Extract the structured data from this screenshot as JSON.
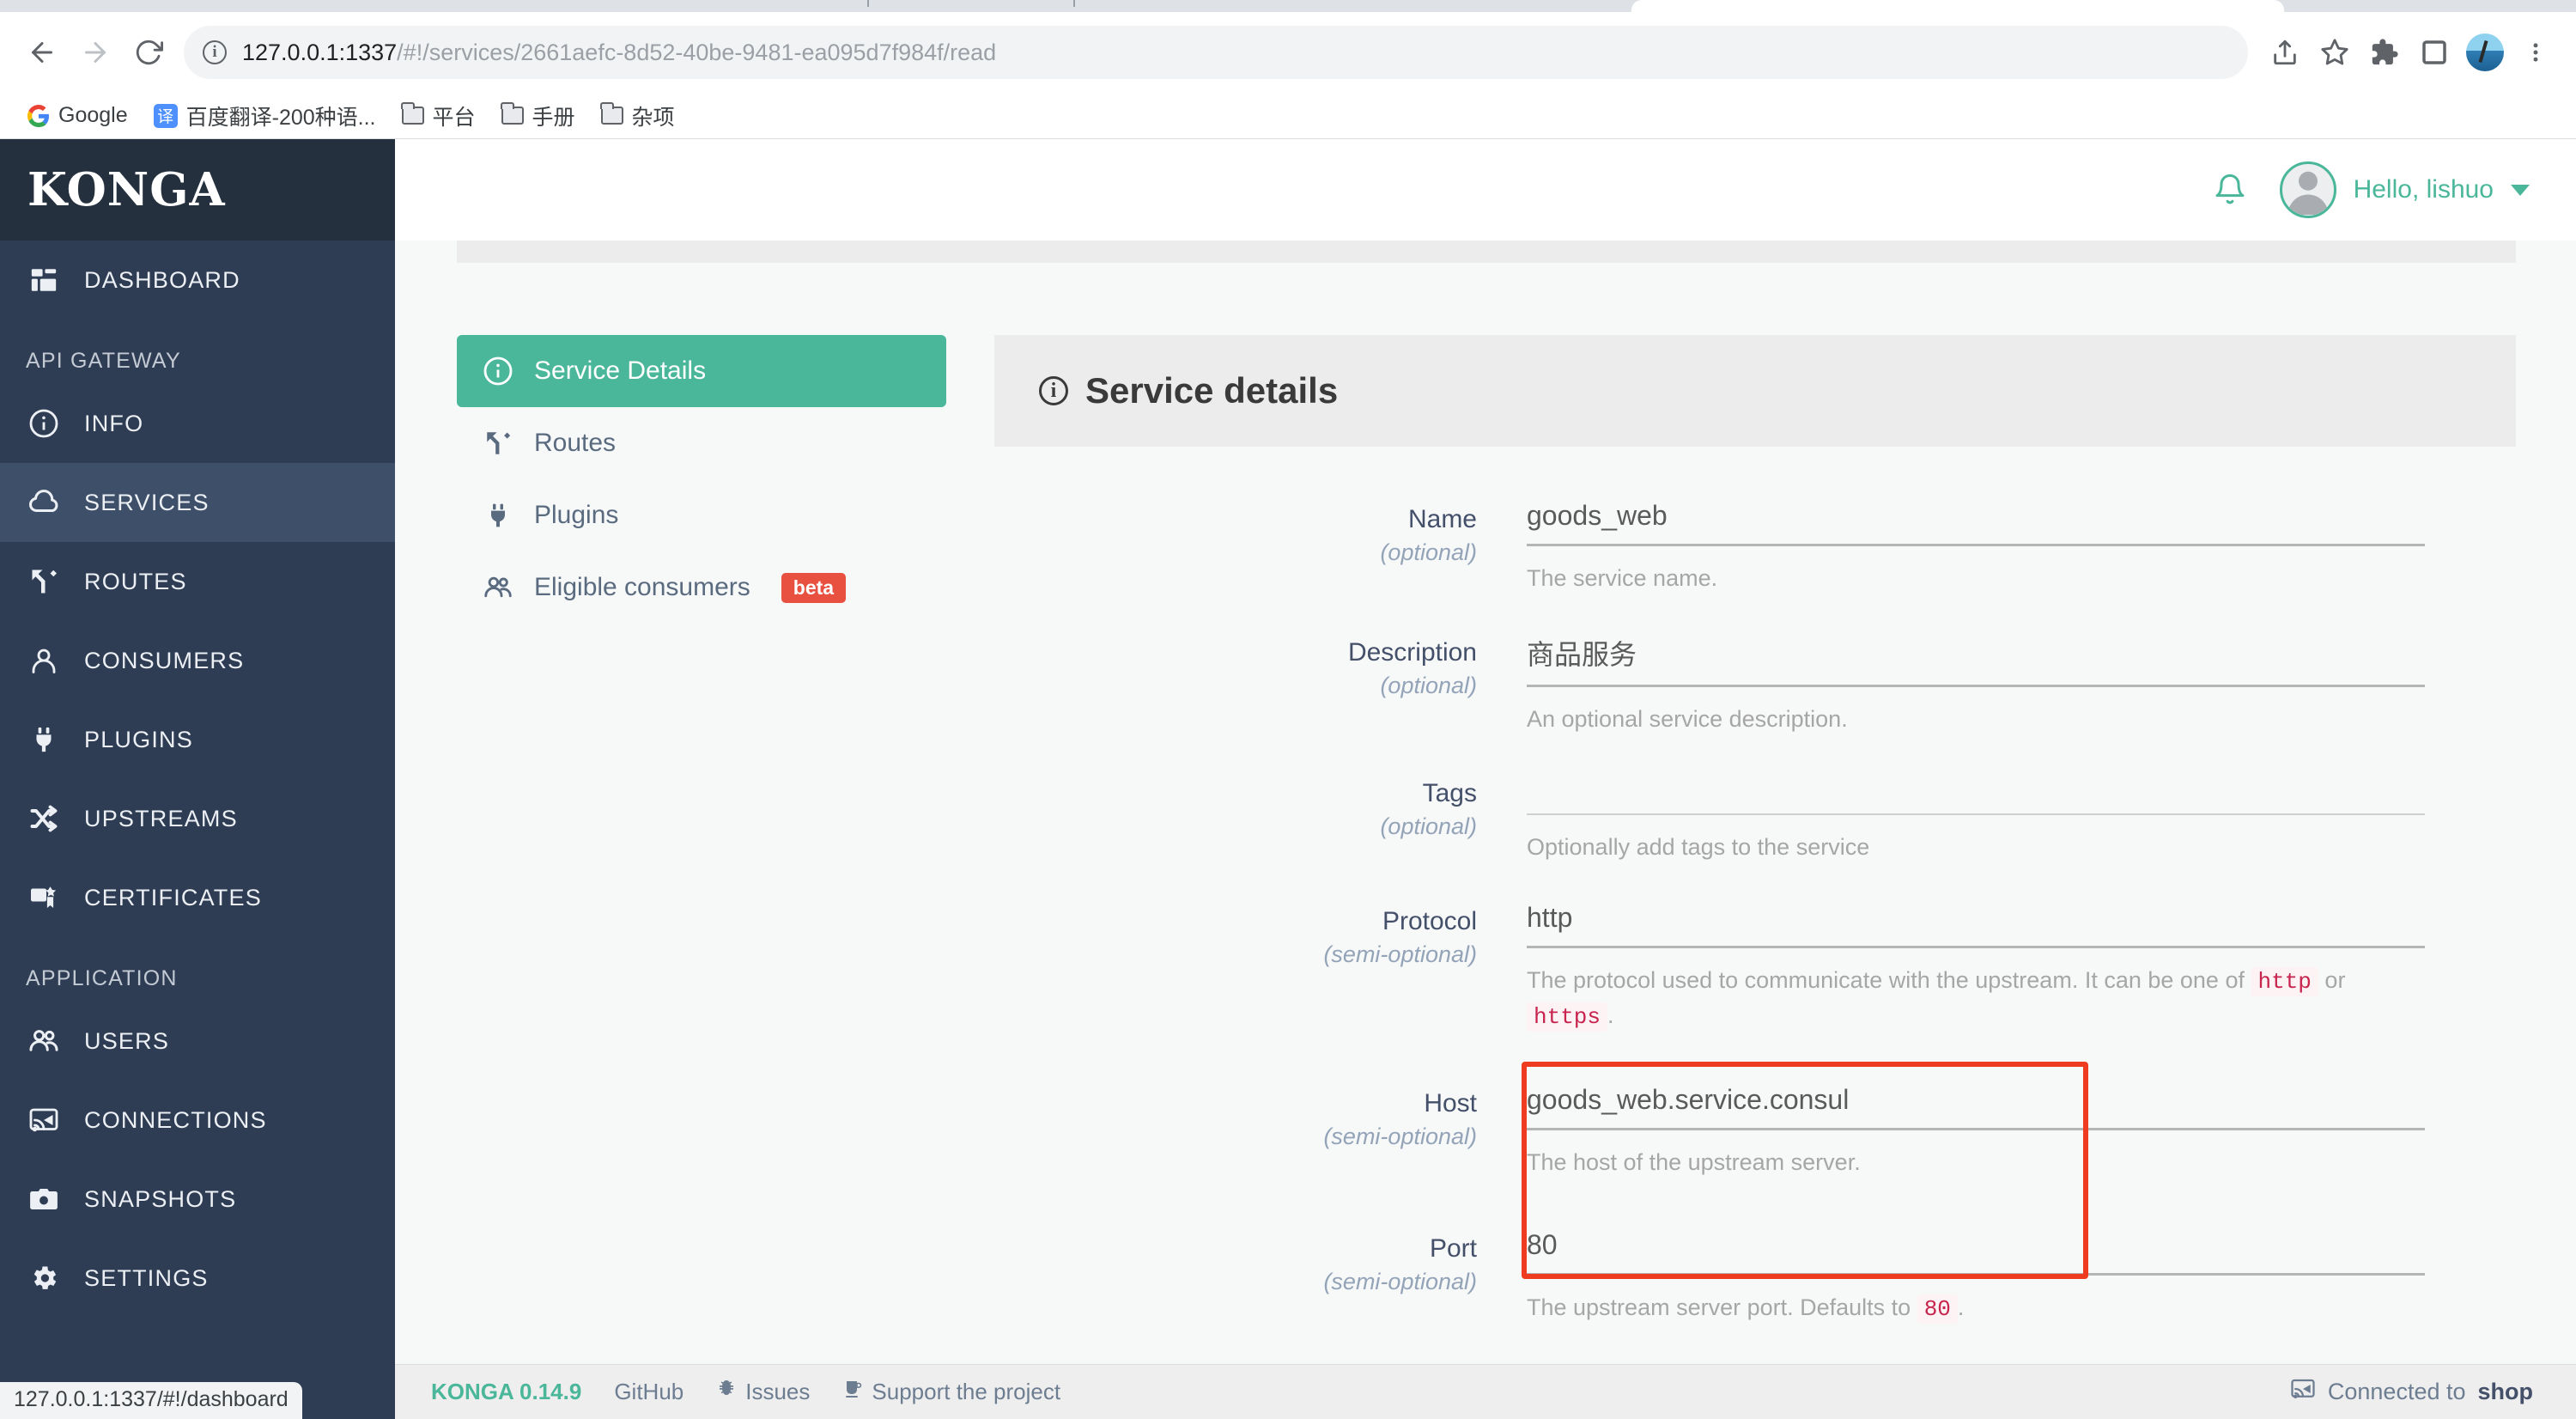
{
  "browser": {
    "url_host": "127.0.0.1:1337",
    "url_path": "/#!/services/2661aefc-8d52-40be-9481-ea095d7f984f/read",
    "back_icon": "back-arrow-icon",
    "forward_icon": "forward-arrow-icon",
    "reload_icon": "reload-icon",
    "site_info_icon": "site-info-icon",
    "share_icon": "share-icon",
    "bookmark_icon": "star-icon",
    "extensions_icon": "puzzle-piece-icon",
    "sidepanel_icon": "side-panel-icon",
    "menu_icon": "three-dot-menu-icon",
    "bookmarks": [
      {
        "label": "Google",
        "icon": "google-icon"
      },
      {
        "label": "百度翻译-200种语...",
        "icon": "baidu-translate-icon"
      },
      {
        "label": "平台",
        "icon": "folder-icon"
      },
      {
        "label": "手册",
        "icon": "folder-icon"
      },
      {
        "label": "杂项",
        "icon": "folder-icon"
      }
    ]
  },
  "status_bar": {
    "text": "127.0.0.1:1337/#!/dashboard"
  },
  "sidebar": {
    "logo": "KONGA",
    "items": [
      {
        "label": "DASHBOARD",
        "icon": "dashboard-grid-icon",
        "active": false
      },
      {
        "section": "API GATEWAY"
      },
      {
        "label": "INFO",
        "icon": "info-circle-icon",
        "active": false
      },
      {
        "label": "SERVICES",
        "icon": "cloud-icon",
        "active": true
      },
      {
        "label": "ROUTES",
        "icon": "routes-fork-icon",
        "active": false
      },
      {
        "label": "CONSUMERS",
        "icon": "person-icon",
        "active": false
      },
      {
        "label": "PLUGINS",
        "icon": "plug-icon",
        "active": false
      },
      {
        "label": "UPSTREAMS",
        "icon": "shuffle-icon",
        "active": false
      },
      {
        "label": "CERTIFICATES",
        "icon": "certificate-icon",
        "active": false
      },
      {
        "section": "APPLICATION"
      },
      {
        "label": "USERS",
        "icon": "people-icon",
        "active": false
      },
      {
        "label": "CONNECTIONS",
        "icon": "broadcast-icon",
        "active": false
      },
      {
        "label": "SNAPSHOTS",
        "icon": "camera-icon",
        "active": false
      },
      {
        "label": "SETTINGS",
        "icon": "gear-icon",
        "active": false
      }
    ]
  },
  "topbar": {
    "bell_icon": "notification-bell-icon",
    "avatar_icon": "user-avatar-icon",
    "greeting": "Hello, lishuo",
    "caret_icon": "chevron-down-icon"
  },
  "tabs": [
    {
      "label": "Service Details",
      "icon": "info-circle-icon",
      "active": true,
      "badge": ""
    },
    {
      "label": "Routes",
      "icon": "routes-fork-icon",
      "active": false,
      "badge": ""
    },
    {
      "label": "Plugins",
      "icon": "plug-icon",
      "active": false,
      "badge": ""
    },
    {
      "label": "Eligible consumers",
      "icon": "people-icon",
      "active": false,
      "badge": "beta"
    }
  ],
  "panel": {
    "title": "Service details",
    "icon": "info-circle-icon",
    "fields": [
      {
        "label": "Name",
        "optional": "(optional)",
        "value": "goods_web",
        "help": "The service name."
      },
      {
        "label": "Description",
        "optional": "(optional)",
        "value": "商品服务",
        "help": "An optional service description."
      },
      {
        "label": "Tags",
        "optional": "(optional)",
        "value": "",
        "help": "Optionally add tags to the service"
      },
      {
        "label": "Protocol",
        "optional": "(semi-optional)",
        "value": "http",
        "help_pre": "The protocol used to communicate with the upstream. It can be one of",
        "help_code1": "http",
        "help_mid": "or",
        "help_code2": "https",
        "help_post": "."
      },
      {
        "label": "Host",
        "optional": "(semi-optional)",
        "value": "goods_web.service.consul",
        "help": "The host of the upstream server."
      },
      {
        "label": "Port",
        "optional": "(semi-optional)",
        "value": "80",
        "help_pre": "The upstream server port. Defaults to",
        "help_code1": "80",
        "help_post": "."
      }
    ]
  },
  "annotation": {
    "color": "#ef3b1f",
    "target": "host-and-port-fields"
  },
  "footer": {
    "version": "KONGA 0.14.9",
    "github": "GitHub",
    "issues": "Issues",
    "issues_icon": "bug-icon",
    "support": "Support the project",
    "support_icon": "coffee-cup-icon",
    "connection_icon": "broadcast-icon",
    "connection_prefix": "Connected to",
    "connection_name": "shop"
  },
  "colors": {
    "accent_green": "#4ab69a",
    "sidebar_bg": "#2e3d54",
    "sidebar_logo_bg": "#25303f",
    "sidebar_active": "#3d4f69",
    "badge_red": "#e8503f",
    "annotation_red": "#ef3b1f",
    "code_red": "#c7254e"
  }
}
